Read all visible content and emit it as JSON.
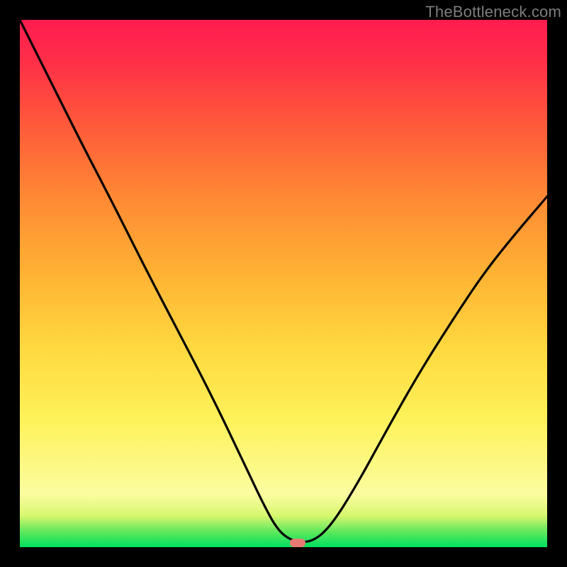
{
  "watermark": "TheBottleneck.com",
  "marker": {
    "x_frac": 0.527,
    "y_frac": 0.992
  },
  "chart_data": {
    "type": "line",
    "title": "",
    "xlabel": "",
    "ylabel": "",
    "xlim": [
      0,
      1
    ],
    "ylim": [
      0,
      1
    ],
    "series": [
      {
        "name": "bottleneck-curve",
        "x": [
          0.0,
          0.06,
          0.12,
          0.18,
          0.24,
          0.3,
          0.36,
          0.42,
          0.46,
          0.49,
          0.52,
          0.555,
          0.59,
          0.64,
          0.7,
          0.76,
          0.82,
          0.88,
          0.94,
          1.0
        ],
        "y": [
          1.0,
          0.88,
          0.76,
          0.645,
          0.525,
          0.41,
          0.295,
          0.17,
          0.085,
          0.03,
          0.01,
          0.01,
          0.04,
          0.12,
          0.23,
          0.335,
          0.43,
          0.52,
          0.595,
          0.665
        ]
      }
    ],
    "marker_point": {
      "x": 0.527,
      "y": 0.008
    }
  }
}
